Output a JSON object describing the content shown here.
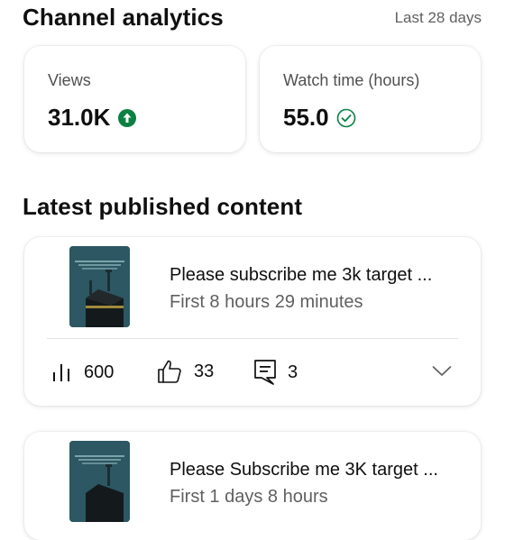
{
  "header": {
    "title": "Channel analytics",
    "period": "Last 28 days"
  },
  "metrics": [
    {
      "label": "Views",
      "value": "31.0K",
      "icon": "arrow-up-circle-icon",
      "icon_color": "#0b8043"
    },
    {
      "label": "Watch time (hours)",
      "value": "55.0",
      "icon": "check-circle-icon",
      "icon_color": "#0b8043"
    }
  ],
  "latest": {
    "title": "Latest published content",
    "items": [
      {
        "title": "Please subscribe me 3k target ...",
        "subtitle": "First 8 hours 29 minutes",
        "views": "600",
        "likes": "33",
        "comments": "3"
      },
      {
        "title": "Please Subscribe me 3K target ...",
        "subtitle": "First 1 days 8 hours"
      }
    ]
  }
}
